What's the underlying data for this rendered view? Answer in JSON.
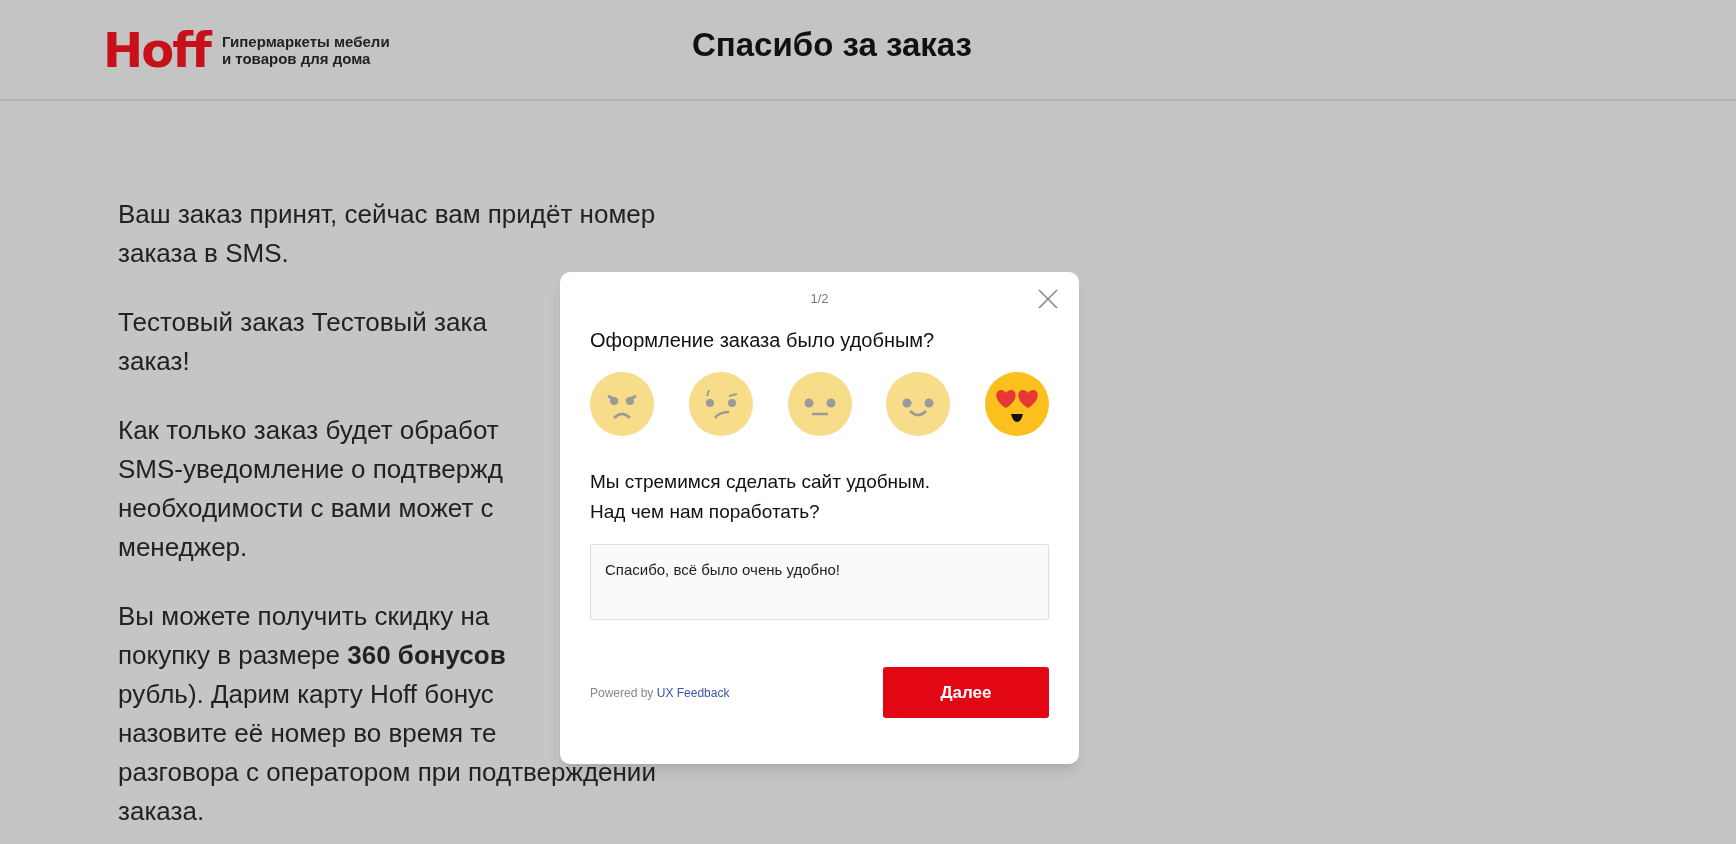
{
  "header": {
    "logo": "Hoff",
    "tagline": [
      "Гипермаркеты мебели",
      "и товаров для дома"
    ],
    "title": "Спасибо за заказ"
  },
  "message": {
    "paragraphs": [
      [
        "Ваш заказ принят, сейчас вам придёт номер",
        "заказа в SMS."
      ],
      [
        "Тестовый заказ Тестовый зака",
        "заказ!"
      ],
      [
        "Как только заказ будет обработ",
        "SMS-уведомление о подтвержд",
        "необходимости с вами может с",
        "менеджер."
      ],
      [
        "Вы можете получить скидку на",
        "покупку в размере **360 бонусов**",
        "рубль). Дарим карту Hoff бонус",
        "назовите её номер во время те",
        "разговора с оператором при подтверждении",
        "заказа."
      ]
    ]
  },
  "survey": {
    "step": "1/2",
    "question": "Оформление заказа было удобным?",
    "ratings": [
      {
        "kind": "angry",
        "selected": false
      },
      {
        "kind": "doubtful",
        "selected": false
      },
      {
        "kind": "neutral",
        "selected": false
      },
      {
        "kind": "smile",
        "selected": false
      },
      {
        "kind": "love",
        "selected": true
      }
    ],
    "followup": [
      "Мы стремимся сделать сайт удобным.",
      "Над чем нам поработать?"
    ],
    "answer": {
      "value": "Спасибо, всё было очень удобно!"
    },
    "powered_by": {
      "text": "Powered by",
      "link": "UX Feedback"
    },
    "button": "Далее"
  }
}
